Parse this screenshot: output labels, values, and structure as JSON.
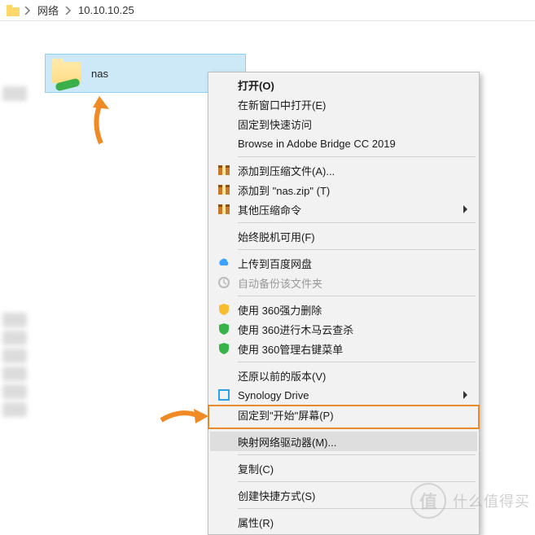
{
  "breadcrumb": {
    "parent": "网络",
    "current": "10.10.10.25"
  },
  "folder": {
    "name": "nas"
  },
  "menu": {
    "open": "打开(O)",
    "open_new_window": "在新窗口中打开(E)",
    "pin_quick_access": "固定到快速访问",
    "browse_bridge": "Browse in Adobe Bridge CC 2019",
    "add_archive": "添加到压缩文件(A)...",
    "add_nas_zip": "添加到 \"nas.zip\" (T)",
    "other_zip": "其他压缩命令",
    "always_offline": "始终脱机可用(F)",
    "upload_baidu": "上传到百度网盘",
    "auto_backup": "自动备份该文件夹",
    "use_360_force_delete": "使用 360强力删除",
    "use_360_trojan_scan": "使用 360进行木马云查杀",
    "use_360_right_menu": "使用 360管理右键菜单",
    "restore_previous": "还原以前的版本(V)",
    "synology_drive": "Synology Drive",
    "pin_start": "固定到\"开始\"屏幕(P)",
    "map_network_drive": "映射网络驱动器(M)...",
    "copy": "复制(C)",
    "create_shortcut": "创建快捷方式(S)",
    "properties": "属性(R)"
  },
  "watermark": {
    "symbol": "值",
    "text": "什么值得买"
  }
}
